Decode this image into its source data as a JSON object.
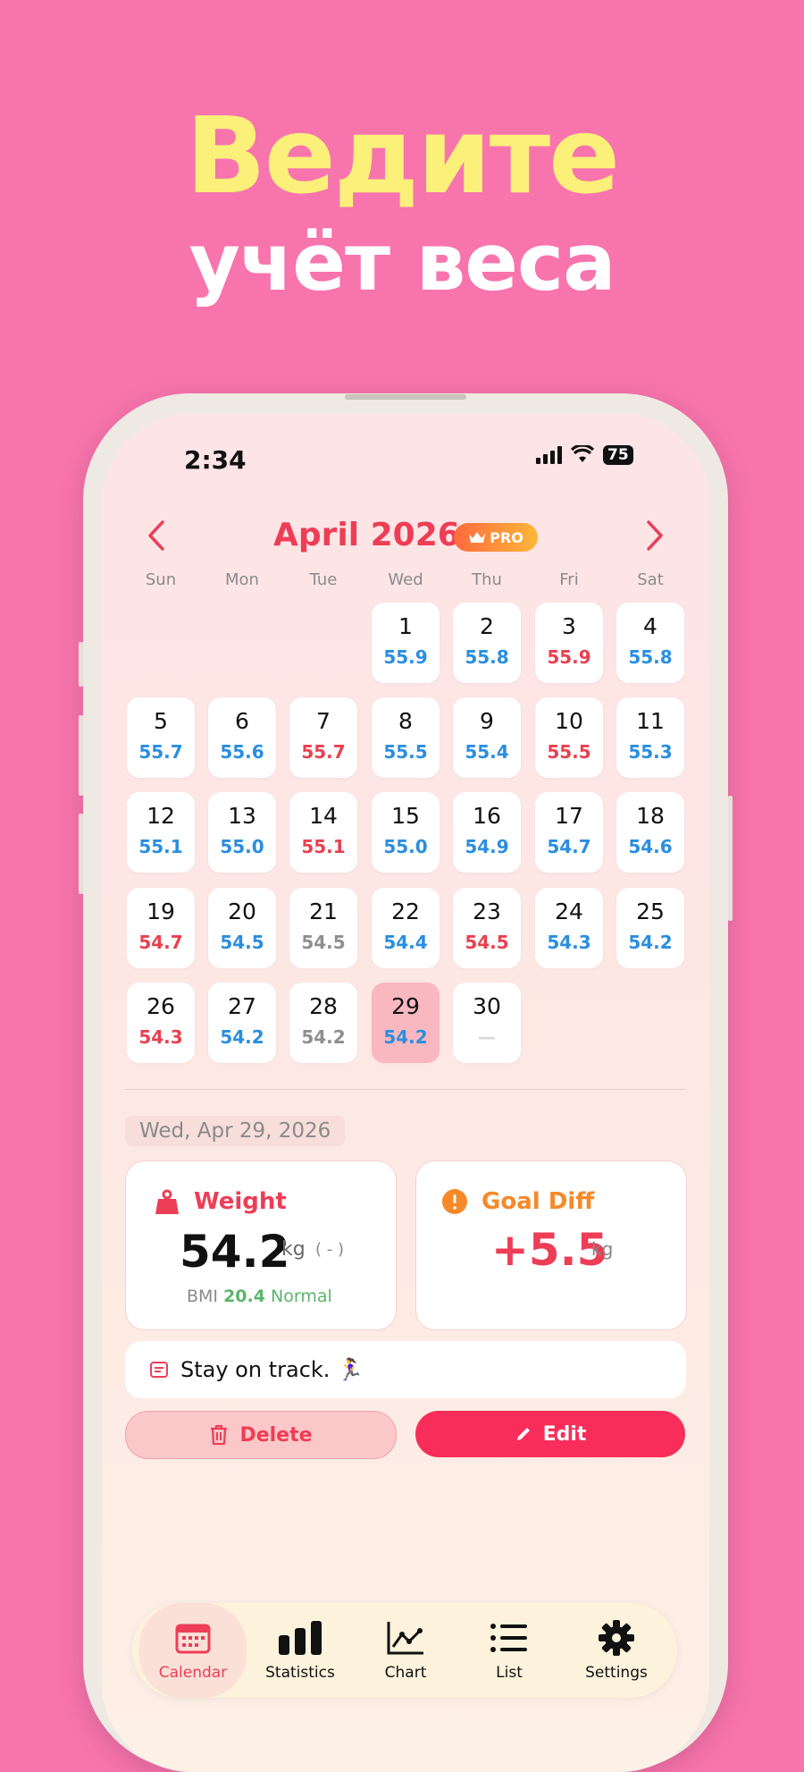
{
  "hero": {
    "line1": "Ведите",
    "line2": "учёт веса"
  },
  "status": {
    "time": "2:34",
    "battery": "75"
  },
  "calendar": {
    "month_title": "April 2026",
    "pro_badge": "PRO",
    "weekdays": [
      "Sun",
      "Mon",
      "Tue",
      "Wed",
      "Thu",
      "Fri",
      "Sat"
    ],
    "days": [
      {
        "day": "1",
        "weight": "55.9",
        "color": "blue"
      },
      {
        "day": "2",
        "weight": "55.8",
        "color": "blue"
      },
      {
        "day": "3",
        "weight": "55.9",
        "color": "red"
      },
      {
        "day": "4",
        "weight": "55.8",
        "color": "blue"
      },
      {
        "day": "5",
        "weight": "55.7",
        "color": "blue"
      },
      {
        "day": "6",
        "weight": "55.6",
        "color": "blue"
      },
      {
        "day": "7",
        "weight": "55.7",
        "color": "red"
      },
      {
        "day": "8",
        "weight": "55.5",
        "color": "blue"
      },
      {
        "day": "9",
        "weight": "55.4",
        "color": "blue"
      },
      {
        "day": "10",
        "weight": "55.5",
        "color": "red"
      },
      {
        "day": "11",
        "weight": "55.3",
        "color": "blue"
      },
      {
        "day": "12",
        "weight": "55.1",
        "color": "blue"
      },
      {
        "day": "13",
        "weight": "55.0",
        "color": "blue"
      },
      {
        "day": "14",
        "weight": "55.1",
        "color": "red"
      },
      {
        "day": "15",
        "weight": "55.0",
        "color": "blue"
      },
      {
        "day": "16",
        "weight": "54.9",
        "color": "blue"
      },
      {
        "day": "17",
        "weight": "54.7",
        "color": "blue"
      },
      {
        "day": "18",
        "weight": "54.6",
        "color": "blue"
      },
      {
        "day": "19",
        "weight": "54.7",
        "color": "red"
      },
      {
        "day": "20",
        "weight": "54.5",
        "color": "blue"
      },
      {
        "day": "21",
        "weight": "54.5",
        "color": "gray"
      },
      {
        "day": "22",
        "weight": "54.4",
        "color": "blue"
      },
      {
        "day": "23",
        "weight": "54.5",
        "color": "red"
      },
      {
        "day": "24",
        "weight": "54.3",
        "color": "blue"
      },
      {
        "day": "25",
        "weight": "54.2",
        "color": "blue"
      },
      {
        "day": "26",
        "weight": "54.3",
        "color": "red"
      },
      {
        "day": "27",
        "weight": "54.2",
        "color": "blue"
      },
      {
        "day": "28",
        "weight": "54.2",
        "color": "gray"
      },
      {
        "day": "29",
        "weight": "54.2",
        "color": "blue",
        "selected": true
      },
      {
        "day": "30",
        "weight": "—",
        "color": "dash"
      }
    ],
    "first_weekday_index": 3
  },
  "detail": {
    "date": "Wed, Apr 29, 2026",
    "weight_label": "Weight",
    "weight_value": "54.2",
    "weight_unit": "kg",
    "weight_change": "( - )",
    "bmi_label": "BMI",
    "bmi_value": "20.4",
    "bmi_status": "Normal",
    "goal_label": "Goal Diff",
    "goal_value": "+5.5",
    "goal_unit": "kg",
    "note": "Stay on track. 🏃‍♀️",
    "delete_label": "Delete",
    "edit_label": "Edit"
  },
  "tabs": [
    {
      "label": "Calendar",
      "icon": "calendar-icon",
      "active": true
    },
    {
      "label": "Statistics",
      "icon": "bar-chart-icon",
      "active": false
    },
    {
      "label": "Chart",
      "icon": "line-chart-icon",
      "active": false
    },
    {
      "label": "List",
      "icon": "list-icon",
      "active": false
    },
    {
      "label": "Settings",
      "icon": "gear-icon",
      "active": false
    }
  ],
  "colors": {
    "accent": "#ee3d56",
    "blue": "#2a8ee0",
    "background": "#f874ad",
    "hero_yellow": "#faf07a"
  }
}
